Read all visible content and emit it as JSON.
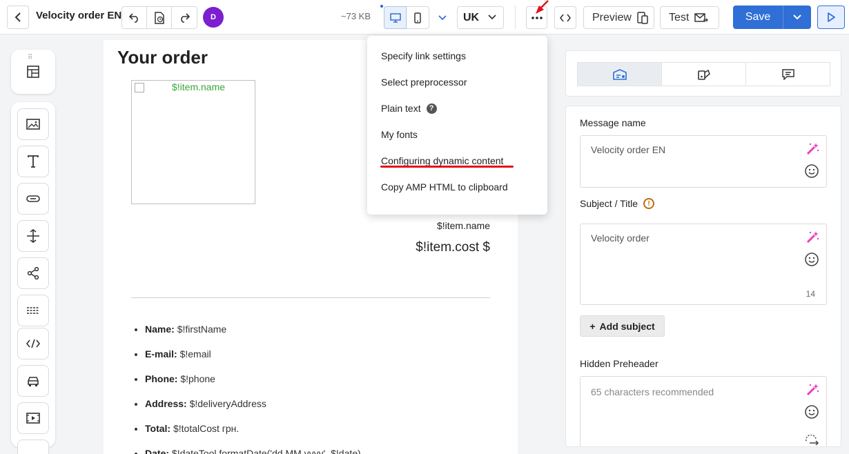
{
  "header": {
    "title": "Velocity order EN",
    "avatar_initial": "D",
    "size": "~73 KB",
    "language": "UK",
    "preview_label": "Preview",
    "test_label": "Test",
    "save_label": "Save"
  },
  "menu": {
    "items": [
      "Specify link settings",
      "Select preprocessor",
      "Plain text",
      "My fonts",
      "Configuring dynamic content",
      "Copy AMP HTML to clipboard"
    ]
  },
  "canvas": {
    "title": "Your order",
    "image_alt": "$!item.name",
    "item_name": "$!item.name",
    "item_cost": "$!item.cost $",
    "details": [
      {
        "label": "Name:",
        "value": "$!firstName"
      },
      {
        "label": "E-mail:",
        "value": "$!email"
      },
      {
        "label": "Phone:",
        "value": "$!phone"
      },
      {
        "label": "Address:",
        "value": "$!deliveryAddress"
      },
      {
        "label": "Total:",
        "value": "$!totalCost грн."
      },
      {
        "label": "Date:",
        "value": "$!dateTool.formatDate('dd.MM.yyyy', $!date)"
      }
    ]
  },
  "panel": {
    "message_name_label": "Message name",
    "message_name_value": "Velocity order EN",
    "subject_label": "Subject / Title",
    "subject_value": "Velocity order",
    "subject_count": "14",
    "add_subject_label": "Add subject",
    "preheader_label": "Hidden Preheader",
    "preheader_placeholder": "65 characters recommended"
  },
  "colors": {
    "accent": "#2f6fd6",
    "avatar": "#7b1fd0",
    "highlight": "#e0101a",
    "wand": "#e83ec4",
    "alt_text": "#3aa53a"
  }
}
